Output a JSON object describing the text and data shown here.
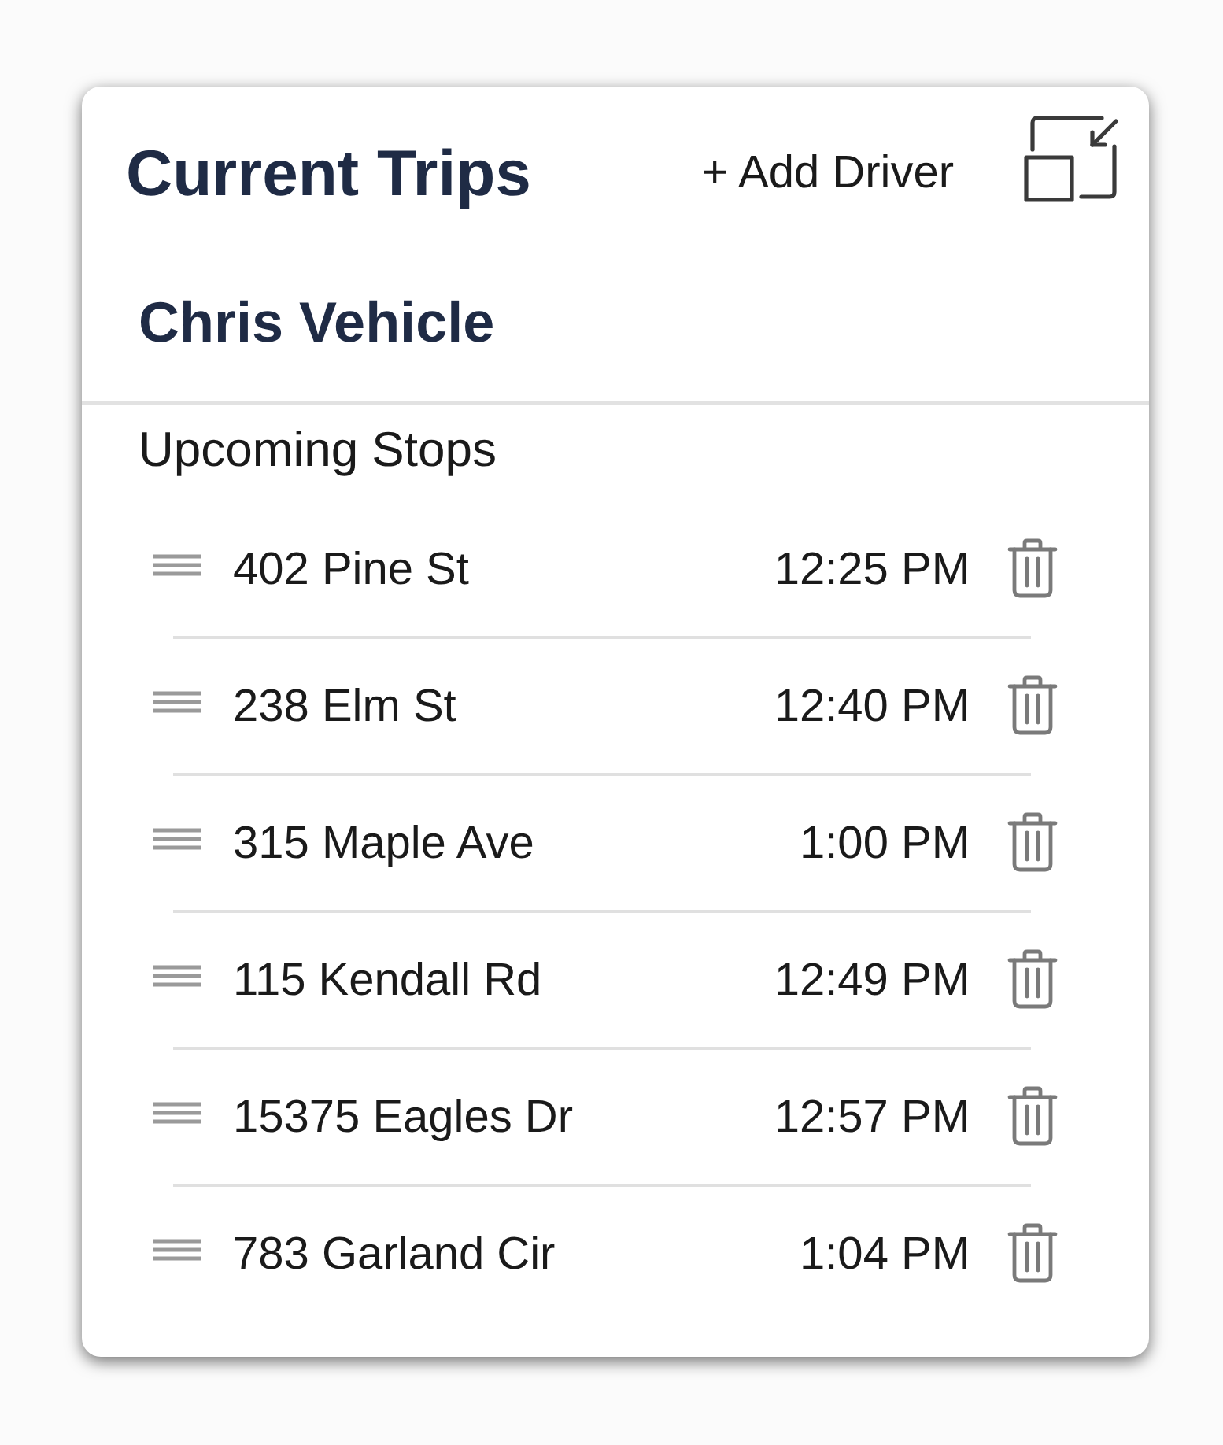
{
  "panel": {
    "title": "Current Trips",
    "add_button": "+ Add Driver"
  },
  "vehicle": {
    "name": "Chris Vehicle"
  },
  "stops": {
    "heading": "Upcoming Stops",
    "items": [
      {
        "address": "402 Pine St",
        "time": "12:25 PM"
      },
      {
        "address": "238 Elm St",
        "time": "12:40 PM"
      },
      {
        "address": "315 Maple Ave",
        "time": "1:00 PM"
      },
      {
        "address": "115 Kendall Rd",
        "time": "12:49 PM"
      },
      {
        "address": "15375 Eagles Dr",
        "time": "12:57 PM"
      },
      {
        "address": "783 Garland Cir",
        "time": "1:04 PM"
      }
    ]
  }
}
